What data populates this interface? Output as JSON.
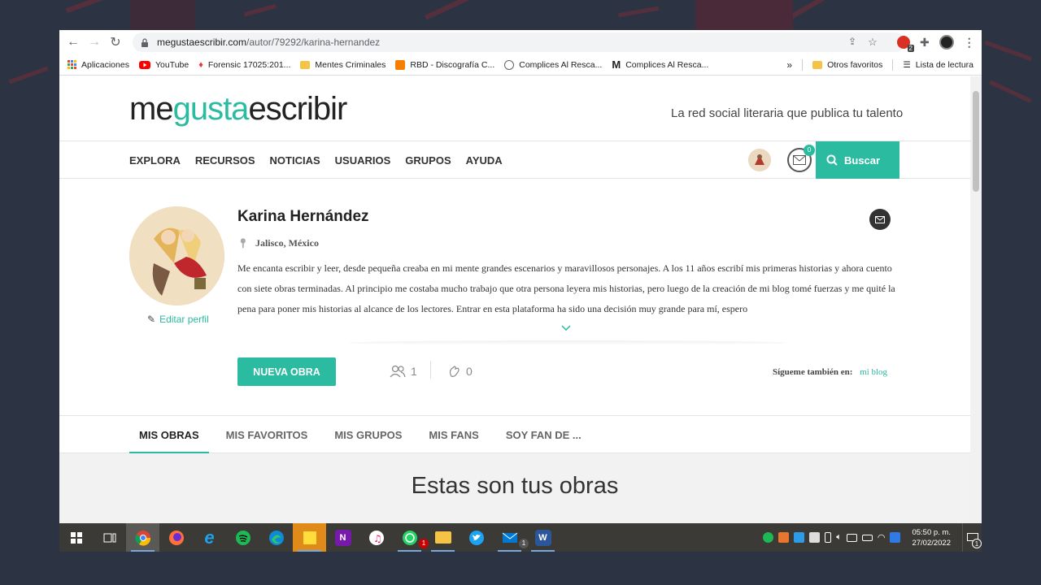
{
  "browser": {
    "url_host": "megustaescribir.com",
    "url_path": "/autor/79292/karina-hernandez",
    "extension_badge": "2"
  },
  "bookmarks": {
    "items": [
      {
        "label": "Aplicaciones",
        "icon": "apps-grid-icon",
        "color": "#4285f4"
      },
      {
        "label": "YouTube",
        "icon": "youtube-icon",
        "color": "#ff0000"
      },
      {
        "label": "Forensic 17025:201...",
        "icon": "forensic-icon",
        "color": "#e53935"
      },
      {
        "label": "Mentes Criminales",
        "icon": "folder-icon",
        "color": "#f6c445"
      },
      {
        "label": "RBD - Discografía C...",
        "icon": "blogger-icon",
        "color": "#f57d00"
      },
      {
        "label": "Complices Al Resca...",
        "icon": "globe-icon",
        "color": "#5f6368"
      },
      {
        "label": "Complices Al Resca...",
        "icon": "medium-icon",
        "color": "#000000"
      }
    ],
    "more": "»",
    "other_favorites": "Otros favoritos",
    "reading_list": "Lista de lectura"
  },
  "site": {
    "logo_part1": "me",
    "logo_accent": "gusta",
    "logo_part2": "escribir",
    "tagline": "La red social literaria que publica tu talento",
    "nav": [
      "EXPLORA",
      "RECURSOS",
      "NOTICIAS",
      "USUARIOS",
      "GRUPOS",
      "AYUDA"
    ],
    "mail_count": "0",
    "search_label": "Buscar",
    "accent_color": "#2bbba1"
  },
  "profile": {
    "name": "Karina Hernández",
    "location": "Jalisco, México",
    "edit_label": "Editar perfil",
    "bio": "Me encanta escribir y leer, desde pequeña creaba en mi mente grandes escenarios y maravillosos personajes. A los 11 años escribí mis primeras historias y ahora cuento con siete obras terminadas. Al principio me costaba mucho trabajo que otra persona leyera mis historias, pero luego de la creación de mi blog tomé fuerzas y me quité la pena para poner mis historias al alcance de los lectores. Entrar en esta plataforma ha sido una decisión muy grande para mí, espero",
    "new_work_label": "NUEVA OBRA",
    "followers": "1",
    "applause": "0",
    "follow_label": "Sígueme también en:",
    "follow_link": "mi blog"
  },
  "tabs": [
    "MIS OBRAS",
    "MIS FAVORITOS",
    "MIS GRUPOS",
    "MIS FANS",
    "SOY FAN DE ..."
  ],
  "works": {
    "title": "Estas son tus obras"
  },
  "taskbar": {
    "time": "05:50 p. m.",
    "date": "27/02/2022",
    "whatsapp_badge": "1",
    "mail_badge": "1",
    "notification_count": "1"
  }
}
